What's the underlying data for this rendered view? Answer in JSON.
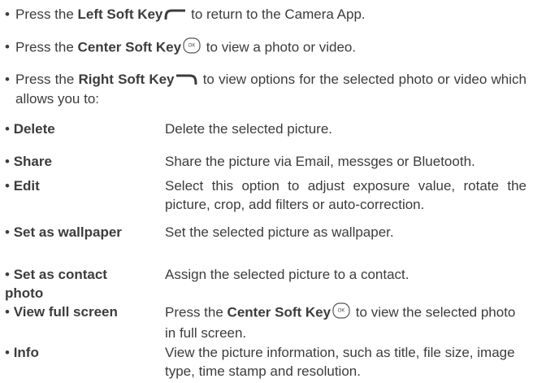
{
  "intro": [
    {
      "pre": "Press the ",
      "key": "Left Soft Key",
      "icon": "left-soft-key-icon",
      "post": " to return to the Camera App."
    },
    {
      "pre": "Press the ",
      "key": "Center Soft Key",
      "icon": "center-ok-key-icon",
      "post": " to view a photo or video."
    },
    {
      "pre": "Press the ",
      "key": "Right Soft Key",
      "icon": "right-soft-key-icon",
      "post": " to view options for the selected photo or video which allows you to:"
    }
  ],
  "bullet": "•",
  "icon_ok_text": "OK",
  "options": [
    {
      "term": "Delete",
      "desc": "Delete the selected picture."
    },
    {
      "term": "Share",
      "desc": "Share the picture via Email, messges or Bluetooth."
    },
    {
      "term": "Edit",
      "desc": "Select this option to adjust exposure value, rotate the picture, crop, add filters or auto-correction."
    },
    {
      "term": "Set as wallpaper",
      "desc": "Set the selected picture as wallpaper."
    },
    {
      "term": "Set as contact photo",
      "desc": "Assign the selected picture to a contact."
    },
    {
      "term": "View full screen",
      "desc_pre": "Press the ",
      "desc_key": "Center Soft Key",
      "desc_icon": "center-ok-key-icon",
      "desc_post": " to view the selected photo in full screen."
    },
    {
      "term": "Info",
      "desc": "View the picture information, such as title, file size, image type, time stamp and resolution."
    }
  ]
}
